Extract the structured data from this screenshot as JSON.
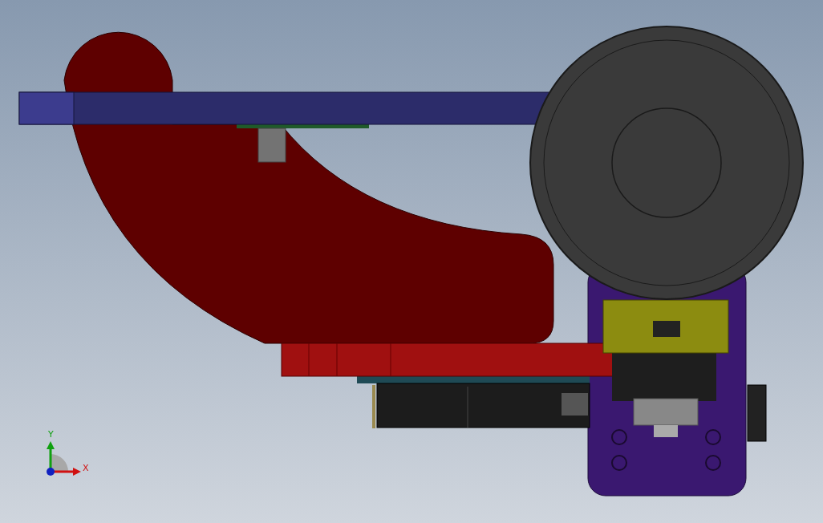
{
  "viewport": {
    "triad": {
      "axes": [
        {
          "kind": "y",
          "label": "Y"
        },
        {
          "kind": "x",
          "label": "X"
        }
      ]
    }
  }
}
